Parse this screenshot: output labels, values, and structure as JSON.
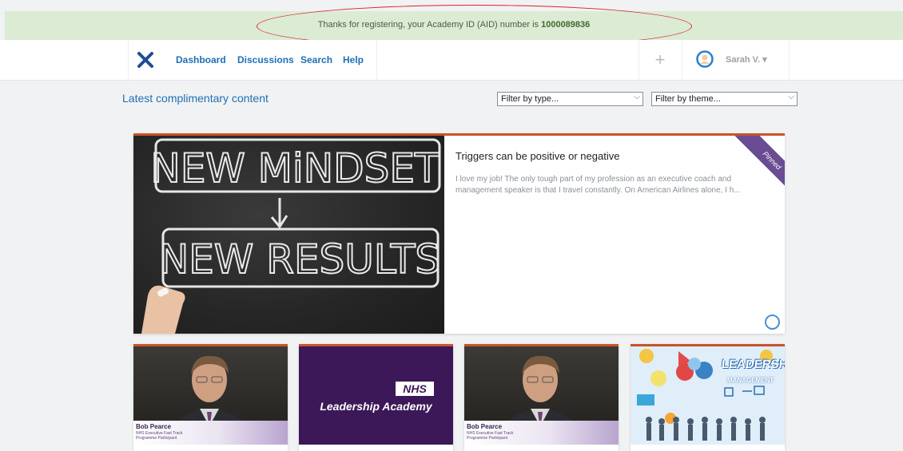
{
  "banner": {
    "message": "Thanks for registering, your Academy ID (AID) number is ",
    "aid_number": "1000089836"
  },
  "nav": {
    "links": [
      "Dashboard",
      "Discussions",
      "Search",
      "Help"
    ],
    "add_label": "+",
    "user_name": "Sarah V. ▾"
  },
  "content": {
    "section_title": "Latest complimentary content",
    "filter_type": "Filter by type...",
    "filter_theme": "Filter by theme..."
  },
  "featured": {
    "title": "Triggers can be positive or negative",
    "excerpt": "I love my job! The only tough part of my profession as an executive coach and management speaker is that I travel constantly. On American Airlines alone, I h...",
    "badge": "Pinned",
    "image_text_top": "NEW MiNDSET",
    "image_text_bottom": "NEW RESULTS"
  },
  "cards": [
    {
      "type": "video",
      "caption_name": "Bob Pearce",
      "caption_role": "NHS Executive Fast Track Programme Participant"
    },
    {
      "type": "nhs",
      "logo": "NHS",
      "subtitle": "Leadership Academy"
    },
    {
      "type": "video",
      "caption_name": "Bob Pearce",
      "caption_role": "NHS Executive Fast Track Programme Participant"
    },
    {
      "type": "leadership",
      "title": "LEADERSHIP",
      "subtitle": "MANAGEMENT"
    }
  ],
  "colors": {
    "brand_blue": "#1d6fb4",
    "banner_green": "#dcebd4",
    "card_accent": "#c8532a",
    "ribbon_purple": "#6a4c93",
    "annotation_red": "#d8232a"
  }
}
